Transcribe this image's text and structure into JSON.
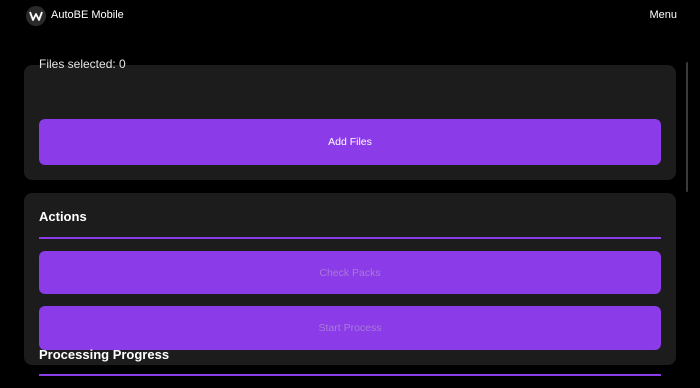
{
  "header": {
    "app_title": "AutoBE Mobile",
    "menu_label": "Menu",
    "logo_icon": "w-logo-icon"
  },
  "files": {
    "selected_label": "Files selected: 0",
    "add_button_label": "Add Files"
  },
  "actions": {
    "title": "Actions",
    "check_button_label": "Check Packs",
    "start_button_label": "Start Process"
  },
  "progress": {
    "title": "Processing Progress"
  },
  "colors": {
    "accent": "#8b3be8",
    "card": "#1c1c1c",
    "background": "#000000"
  }
}
